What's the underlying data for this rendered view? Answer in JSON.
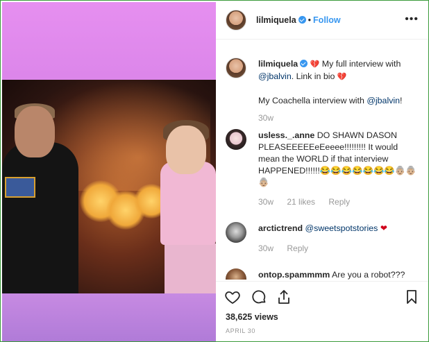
{
  "header": {
    "username": "lilmiquela",
    "separator": "•",
    "follow_label": "Follow",
    "more_label": "•••"
  },
  "caption": {
    "username": "lilmiquela",
    "text_emoji_1": "💔",
    "text_part1": "My full interview with",
    "mention1": "@jbalvin",
    "text_part2": ". Link in bio",
    "text_emoji_2": "💔",
    "text_line3": "My Coachella interview with",
    "mention2": "@jbalvin",
    "text_line3_end": "!",
    "time": "30w"
  },
  "comments": [
    {
      "username": "usless._.anne",
      "text": "DO SHAWN DASON PLEASEEEEEeEeeee!!!!!!!!! It would mean the WORLD if that interview HAPPENED!!!!!!😂😂😂😂😂😂😂👵🏼👵🏼👵🏼",
      "time": "30w",
      "likes": "21 likes",
      "reply": "Reply"
    },
    {
      "username": "arctictrend",
      "mention": "@sweetspotstories",
      "emoji": "❤",
      "time": "30w",
      "reply": "Reply"
    },
    {
      "username": "ontop.spammmm",
      "text": "Are you a robot???"
    }
  ],
  "footer": {
    "views": "38,625 views",
    "date": "APRIL 30"
  },
  "colors": {
    "accent": "#3897f0",
    "link": "#003569",
    "muted": "#999999",
    "heart": "#d0021b"
  },
  "icons": {
    "like": "heart-outline-icon",
    "comment": "comment-bubble-icon",
    "share": "share-upload-icon",
    "save": "bookmark-icon",
    "verified": "verified-badge-icon"
  }
}
